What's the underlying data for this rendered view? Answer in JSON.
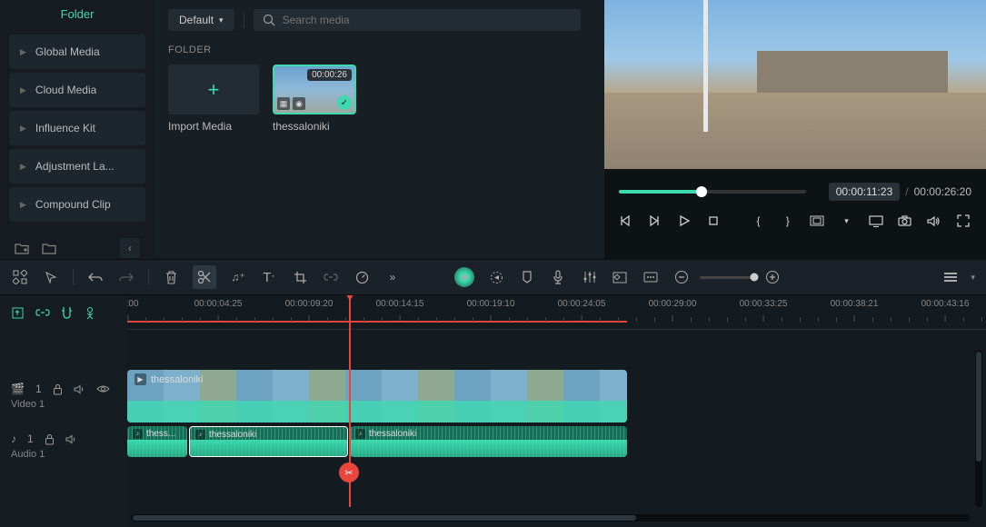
{
  "sidebar": {
    "header": "Folder",
    "items": [
      "Global Media",
      "Cloud Media",
      "Influence Kit",
      "Adjustment La...",
      "Compound Clip"
    ]
  },
  "media": {
    "sort_label": "Default",
    "search_placeholder": "Search media",
    "section_label": "FOLDER",
    "import_label": "Import Media",
    "clip": {
      "name": "thessaloniki",
      "duration": "00:00:26"
    }
  },
  "preview": {
    "current_time": "00:00:11:23",
    "separator": "/",
    "total_time": "00:00:26:20"
  },
  "timeline": {
    "ticks": [
      "00:00",
      "00:00:04:25",
      "00:00:09:20",
      "00:00:14:15",
      "00:00:19:10",
      "00:00:24:05",
      "00:00:29:00",
      "00:00:33:25",
      "00:00:38:21",
      "00:00:43:16"
    ],
    "tracks": {
      "video": {
        "name": "Video 1",
        "index": "1",
        "clip_label": "thessaloniki"
      },
      "audio": {
        "name": "Audio 1",
        "index": "1",
        "clips": [
          {
            "label": "thess..."
          },
          {
            "label": "thessaloniki"
          },
          {
            "label": "thessaloniki"
          }
        ]
      }
    }
  }
}
